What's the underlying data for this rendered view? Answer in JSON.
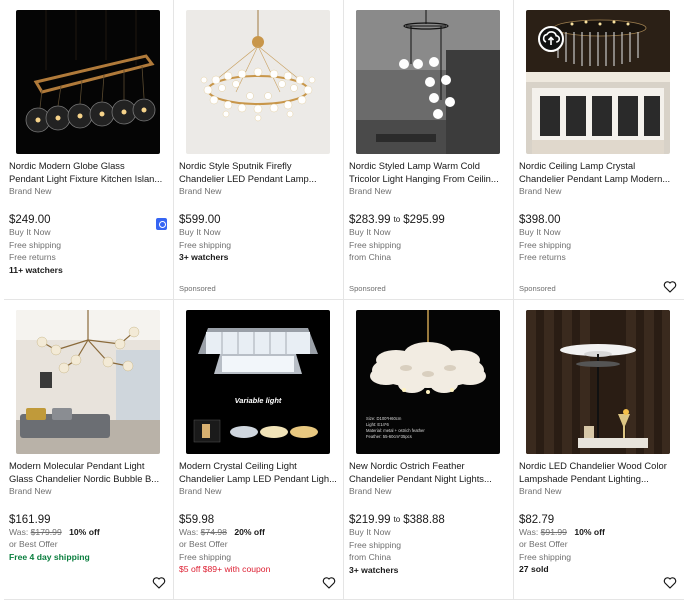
{
  "colors": {
    "text": "#191919",
    "secondary": "#707070",
    "green": "#0a7e3e",
    "red": "#dd1e31",
    "blue_badge": "#3665f3",
    "divider": "#e5e5e5"
  },
  "items": [
    {
      "title_l1": "Nordic Modern Globe Glass",
      "title_l2": "Pendant Light Fixture Kitchen Islan...",
      "condition": "Brand New",
      "price": "$249.00",
      "lines": [
        "Buy It Now",
        "Free shipping",
        "Free returns"
      ],
      "emph": "11+ watchers",
      "sponsored": "",
      "icon": "bookmark-badge-icon"
    },
    {
      "title_l1": "Nordic Style Sputnik Firefly",
      "title_l2": "Chandelier LED Pendant Lamp...",
      "condition": "Brand New",
      "price": "$599.00",
      "lines": [
        "Buy It Now",
        "Free shipping"
      ],
      "emph": "3+ watchers",
      "sponsored": "Sponsored"
    },
    {
      "title_l1": "Nordic Styled Lamp Warm Cold",
      "title_l2": "Tricolor Light Hanging From Ceilin...",
      "condition": "Brand New",
      "price_low": "$283.99",
      "price_to": "to",
      "price_high": "$295.99",
      "lines": [
        "Buy It Now",
        "Free shipping",
        "from China"
      ],
      "sponsored": "Sponsored"
    },
    {
      "title_l1": "Nordic Ceiling Lamp Crystal",
      "title_l2": "Chandelier Pendant Lamp Modern...",
      "condition": "Brand New",
      "price": "$398.00",
      "lines": [
        "Buy It Now",
        "Free shipping",
        "Free returns"
      ],
      "sponsored": "Sponsored",
      "icon": "upload-cloud-icon"
    },
    {
      "title_l1": "Modern Molecular Pendant Light",
      "title_l2": "Glass Chandelier Nordic Bubble B...",
      "condition": "Brand New",
      "price": "$161.99",
      "was_label": "Was:",
      "was_price": "$179.99",
      "off": "10% off",
      "lines": [
        "or Best Offer"
      ],
      "green": "Free 4 day shipping"
    },
    {
      "title_l1": "Modern Crystal Ceiling Light",
      "title_l2": "Chandelier Lamp LED Pendant Ligh...",
      "condition": "Brand New",
      "price": "$59.98",
      "was_label": "Was:",
      "was_price": "$74.98",
      "off": "20% off",
      "lines": [
        "or Best Offer",
        "Free shipping"
      ],
      "red": "$5 off $89+ with coupon",
      "thumb_caption": "Variable light"
    },
    {
      "title_l1": "New Nordic Ostrich Feather",
      "title_l2": "Chandelier Pendant Night Lights...",
      "condition": "Brand New",
      "price_low": "$219.99",
      "price_to": "to",
      "price_high": "$388.88",
      "lines": [
        "Buy It Now",
        "Free shipping",
        "from China"
      ],
      "emph": "3+ watchers",
      "thumb_specs": [
        "Size: D100*H60cm",
        "Light: E14*6",
        "Material: metal + ostrich feather",
        "Feather: 55-60cm*35pcs"
      ]
    },
    {
      "title_l1": "Nordic LED Chandelier Wood Color",
      "title_l2": "Lampshade Pendant Lighting...",
      "condition": "Brand New",
      "price": "$82.79",
      "was_label": "Was:",
      "was_price": "$91.99",
      "off": "10% off",
      "lines": [
        "or Best Offer",
        "Free shipping"
      ],
      "emph": "27 sold"
    }
  ]
}
